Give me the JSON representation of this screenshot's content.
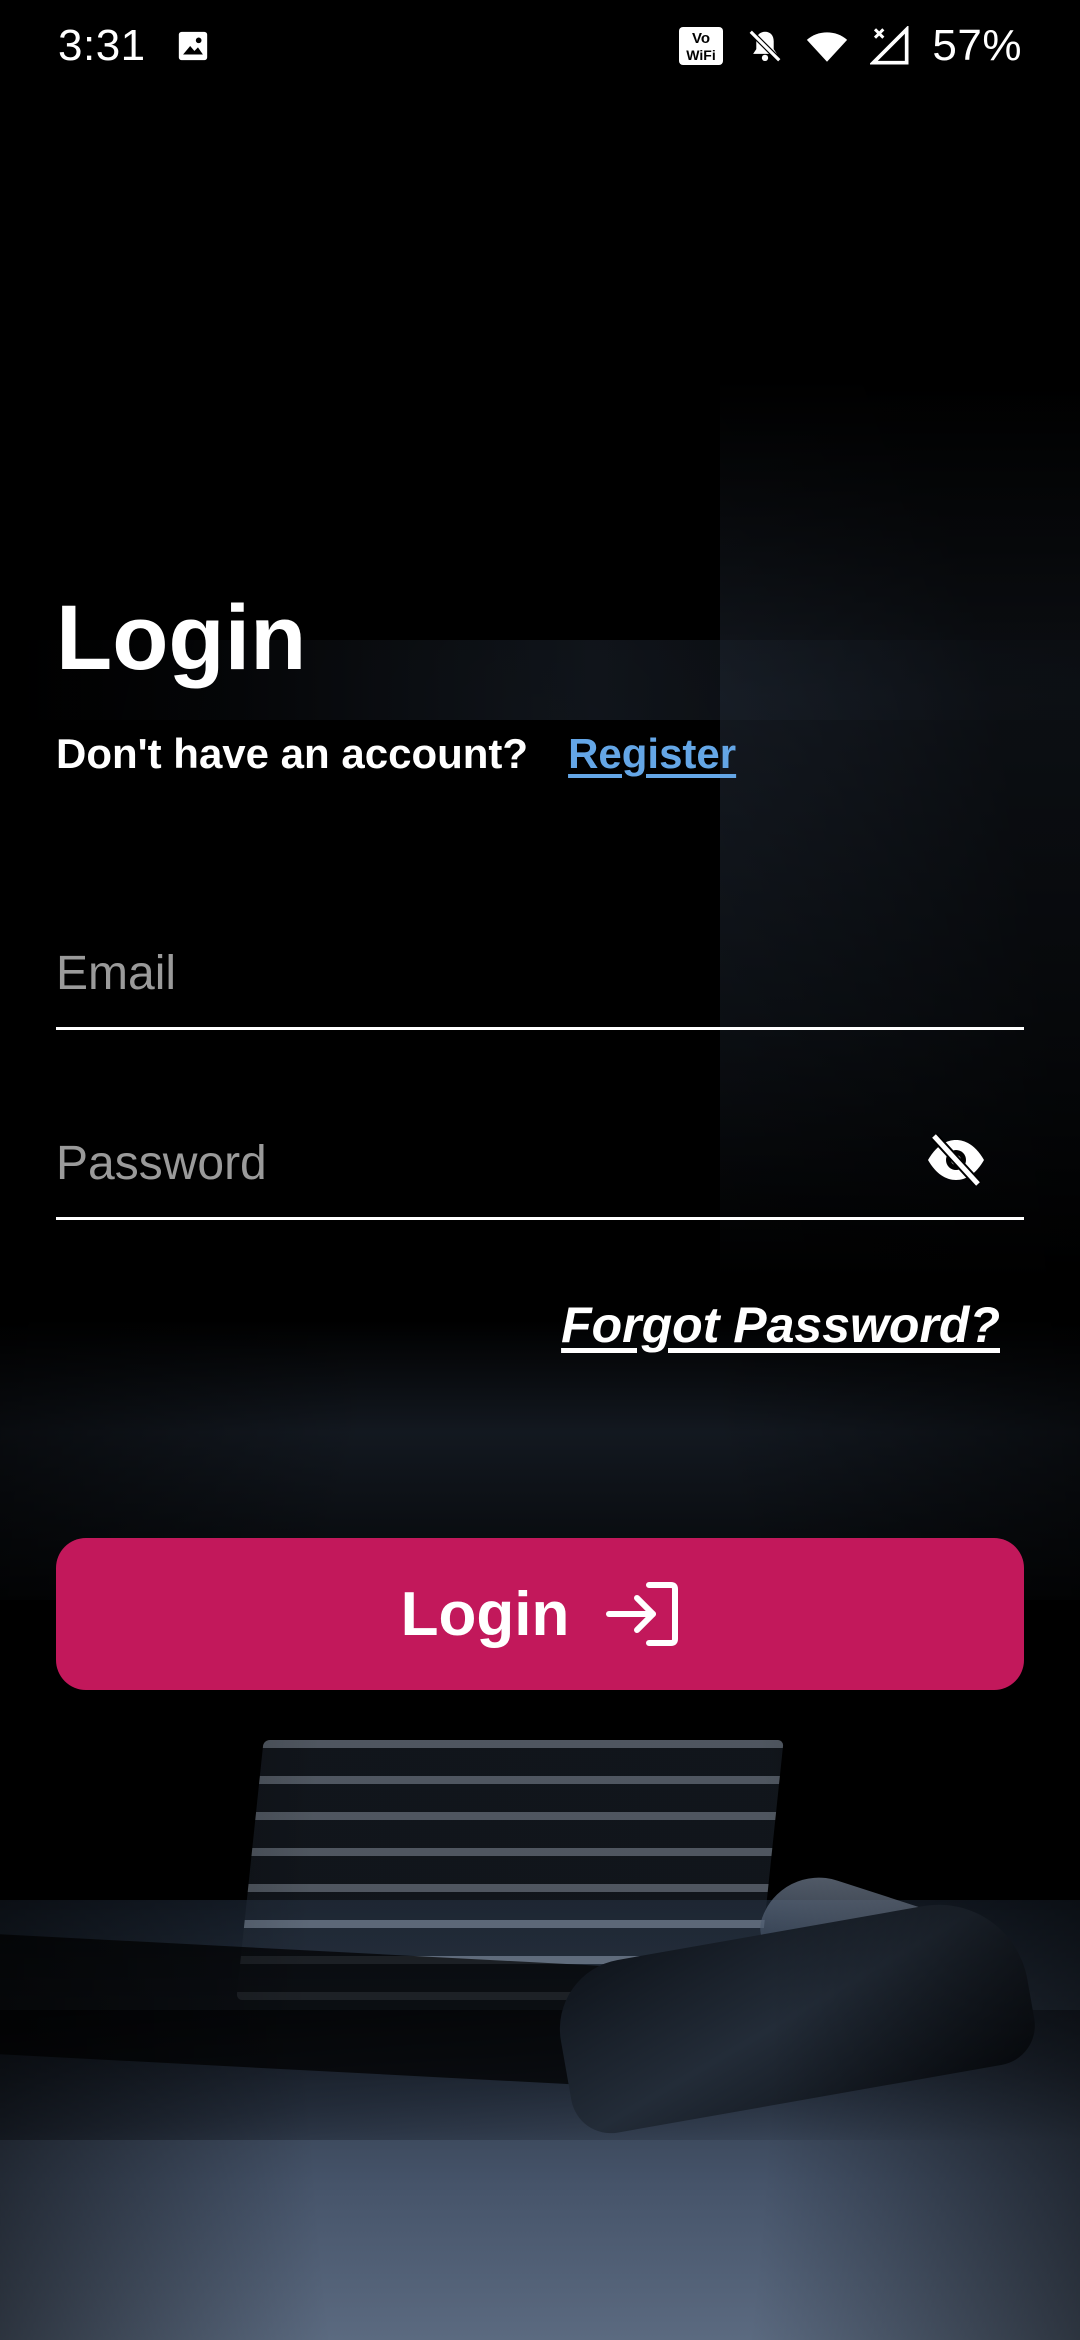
{
  "status_bar": {
    "time": "3:31",
    "battery": "57%",
    "icons": [
      "image-icon",
      "vowifi-icon",
      "mute-bell-icon",
      "wifi-icon",
      "signal-icon"
    ],
    "vowifi_top": "Vo",
    "vowifi_bottom": "WiFi"
  },
  "login": {
    "title": "Login",
    "no_account_text": "Don't have an account?",
    "register_label": "Register",
    "email_placeholder": "Email",
    "email_value": "",
    "password_placeholder": "Password",
    "password_value": "",
    "password_toggle_icon": "eye-off-icon",
    "forgot_password_label": "Forgot Password?",
    "login_button_label": "Login",
    "login_button_icon": "login-arrow-icon"
  },
  "colors": {
    "accent": "#c2185b",
    "link": "#64a6e6",
    "background": "#000000",
    "text": "#ffffff",
    "placeholder": "#9a9a9a"
  }
}
